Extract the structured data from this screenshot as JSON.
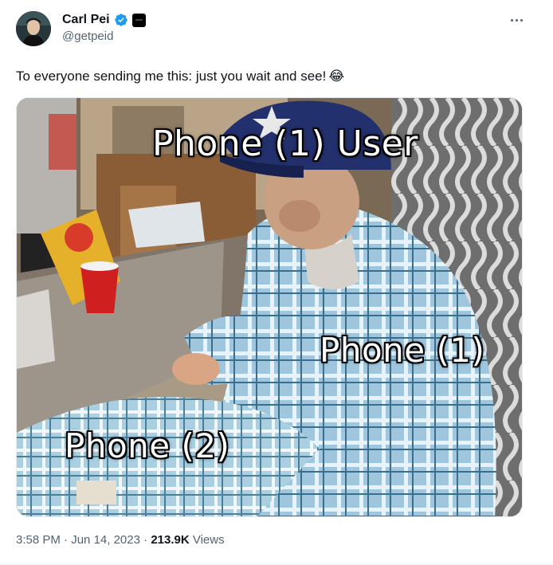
{
  "author": {
    "display_name": "Carl Pei",
    "handle": "@getpeid",
    "verified_color": "#1d9bf0"
  },
  "tweet": {
    "text": "To everyone sending me this: just you wait and see!",
    "emoji": "😂"
  },
  "media": {
    "captions": {
      "top": "Phone (1) User",
      "middle": "Phone (1)",
      "bottom": "Phone (2)"
    }
  },
  "meta": {
    "time": "3:58 PM",
    "separator_1": " · ",
    "date": "Jun 14, 2023",
    "separator_2": " · ",
    "views_count": "213.9K",
    "views_label": " Views"
  },
  "icons": {
    "verified": "verified-badge-icon",
    "affiliate": "affiliate-badge-icon",
    "more": "more-options-icon"
  },
  "colors": {
    "text_primary": "#0f1419",
    "text_secondary": "#536471",
    "accent": "#1d9bf0"
  }
}
